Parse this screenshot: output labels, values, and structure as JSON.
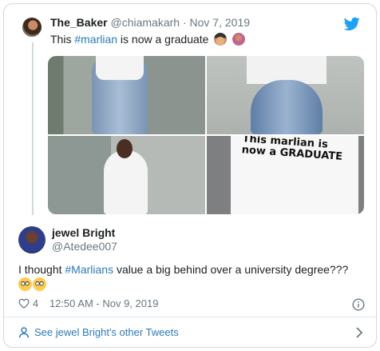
{
  "quoted_tweet": {
    "display_name": "The_Baker",
    "handle": "@chiamakarh",
    "date": "Nov 7, 2019",
    "text_before": "This ",
    "hashtag": "#marlian",
    "text_after": " is now a graduate",
    "emojis": [
      "graduate-emoji",
      "person-shrugging-emoji"
    ],
    "photos": [
      "photo-1",
      "photo-2",
      "photo-3",
      "photo-4"
    ],
    "shirt_text": "This marlian is now a GRADUATE"
  },
  "tweet": {
    "display_name": "jewel Bright",
    "handle": "@Atedee007",
    "text_before": "I thought ",
    "hashtag": "#Marlians",
    "text_after": " value a big behind over a university degree???",
    "emojis": [
      "face-with-rolling-eyes-emoji",
      "face-with-rolling-eyes-emoji"
    ],
    "like_count": "4",
    "time": "12:50 AM - Nov 9, 2019"
  },
  "footer": {
    "link_text": "See jewel Bright's other Tweets"
  },
  "colors": {
    "link": "#2b7bb9",
    "twitter_blue": "#1da1f2",
    "meta_gray": "#697882",
    "border": "#cfd9de"
  }
}
